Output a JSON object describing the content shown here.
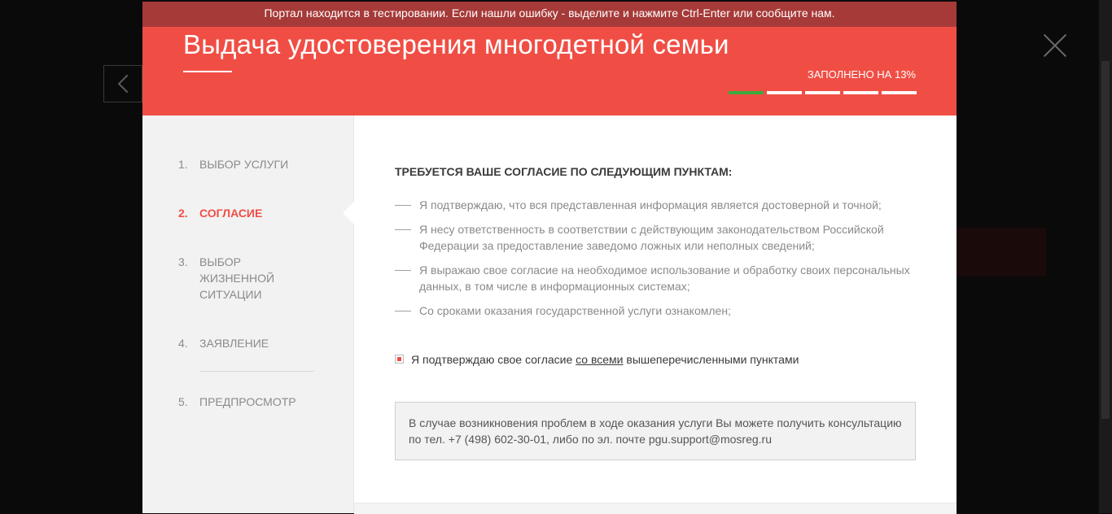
{
  "banner": {
    "text": "Портал находится в тестировании. Если нашли ошибку - выделите и нажмите Ctrl-Enter или сообщите нам."
  },
  "header": {
    "title": "Выдача удостоверения многодетной семьи",
    "progress_label": "ЗАПОЛНЕНО НА 13%",
    "progress_fraction": 0.13,
    "progress_segments": 5,
    "progress_segments_done": 1
  },
  "steps": [
    {
      "num": "1.",
      "label": "ВЫБОР УСЛУГИ",
      "active": false
    },
    {
      "num": "2.",
      "label": "СОГЛАСИЕ",
      "active": true
    },
    {
      "num": "3.",
      "label": "ВЫБОР ЖИЗНЕННОЙ СИТУАЦИИ",
      "active": false
    },
    {
      "num": "4.",
      "label": "ЗАЯВЛЕНИЕ",
      "active": false
    },
    {
      "num": "5.",
      "label": "ПРЕДПРОСМОТР",
      "active": false
    }
  ],
  "consent": {
    "title": "ТРЕБУЕТСЯ ВАШЕ СОГЛАСИЕ ПО СЛЕДУЮЩИМ ПУНКТАМ:",
    "items": [
      "Я подтверждаю, что вся представленная информация является достоверной и точной;",
      "Я несу ответственность в соответствии с действующим законодательством Российской Федерации за предоставление заведомо ложных или неполных сведений;",
      "Я выражаю свое согласие на необходимое использование и обработку своих персональных данных, в том числе в информационных системах;",
      "Со сроками оказания государственной услуги ознакомлен;"
    ],
    "agree_before": "Я подтверждаю свое согласие ",
    "agree_link": "со всеми",
    "agree_after": " вышеперечисленными пунктами",
    "agree_checked": true
  },
  "info": {
    "text": "В случае возникновения проблем в ходе оказания услуги Вы можете получить консультацию по тел. +7 (498) 602-30-01, либо по эл. почте pgu.support@mosreg.ru"
  },
  "colors": {
    "brand_red": "#f04e45",
    "banner_dark_red": "#a63a38",
    "progress_done": "#3daa3d"
  },
  "icons": {
    "back": "chevron-left-icon",
    "close": "close-icon",
    "checkbox": "checkbox-checked-icon"
  }
}
